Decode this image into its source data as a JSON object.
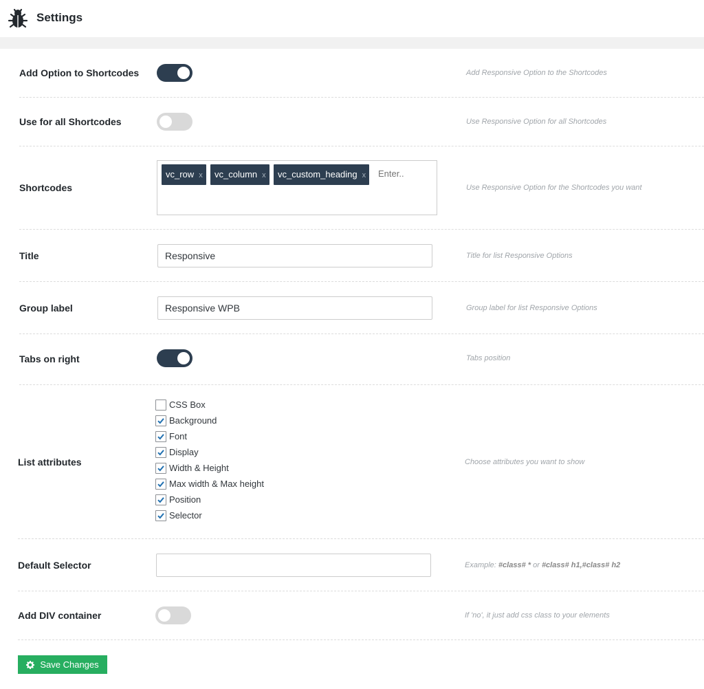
{
  "header": {
    "title": "Settings",
    "icon": "bug-icon"
  },
  "rows": [
    {
      "label": "Add Option to Shortcodes",
      "type": "toggle",
      "state": "on",
      "desc": "Add Responsive Option to the Shortcodes"
    },
    {
      "label": "Use for all Shortcodes",
      "type": "toggle",
      "state": "off",
      "desc": "Use Responsive Option for all Shortcodes"
    },
    {
      "label": "Shortcodes",
      "type": "tags",
      "desc": "Use Responsive Option for the Shortcodes you want"
    },
    {
      "label": "Title",
      "type": "text",
      "value": "Responsive",
      "desc": "Title for list Responsive Options"
    },
    {
      "label": "Group label",
      "type": "text",
      "value": "Responsive WPB",
      "desc": "Group label for list Responsive Options"
    },
    {
      "label": "Tabs on right",
      "type": "toggle",
      "state": "on",
      "desc": "Tabs position"
    },
    {
      "label": "List attributes",
      "type": "checklist",
      "desc": "Choose attributes you want to show"
    },
    {
      "label": "Default Selector",
      "type": "text",
      "value": "",
      "desc_prefix": "Example: ",
      "desc_code1": "#class# *",
      "desc_mid": " or ",
      "desc_code2": "#class# h1,#class# h2"
    },
    {
      "label": "Add DIV container",
      "type": "toggle",
      "state": "off",
      "desc": "If 'no', it just add css class to your elements"
    }
  ],
  "tags": {
    "items": [
      {
        "text": "vc_row",
        "remove": "x"
      },
      {
        "text": "vc_column",
        "remove": "x"
      },
      {
        "text": "vc_custom_heading",
        "remove": "x"
      }
    ],
    "placeholder": "Enter.."
  },
  "checklist": [
    {
      "label": "CSS Box",
      "checked": false
    },
    {
      "label": "Background",
      "checked": true
    },
    {
      "label": "Font",
      "checked": true
    },
    {
      "label": "Display",
      "checked": true
    },
    {
      "label": "Width & Height",
      "checked": true
    },
    {
      "label": "Max width & Max height",
      "checked": true
    },
    {
      "label": "Position",
      "checked": true
    },
    {
      "label": "Selector",
      "checked": true
    }
  ],
  "save_button": {
    "label": "Save Changes",
    "icon": "gear-icon"
  },
  "colors": {
    "accent": "#2d3e50",
    "save": "#27ae60",
    "toggle_off": "#d9d9d9",
    "check": "#2271b1"
  }
}
